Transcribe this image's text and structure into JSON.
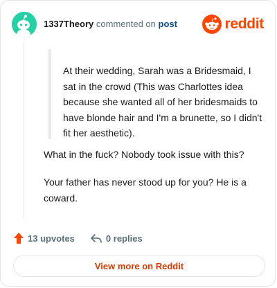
{
  "header": {
    "username": "1337Theory",
    "action": "commented on",
    "post_link": "post",
    "logo_text": "reddit"
  },
  "comment": {
    "quote": "At their wedding, Sarah was a Bridesmaid, I sat in the crowd (This was Charlottes idea because she wanted all of her bridesmaids to have blonde hair and I'm a brunette, so I didn't fit her aesthetic).",
    "paragraphs": [
      "What in the fuck? Nobody took issue with this?",
      "Your father has never stood up for you? He is a coward."
    ]
  },
  "footer": {
    "upvotes": "13 upvotes",
    "replies": "0 replies"
  },
  "button": {
    "label": "View more on Reddit"
  },
  "colors": {
    "brand": "#ff4500",
    "avatar_bg": "#24d1a4",
    "link": "#0a4c8a",
    "muted": "#576f76",
    "button_text": "#d93a00"
  },
  "icons": [
    "snoo-avatar-icon",
    "reddit-logo-icon",
    "upvote-arrow-icon",
    "reply-arrow-icon"
  ]
}
